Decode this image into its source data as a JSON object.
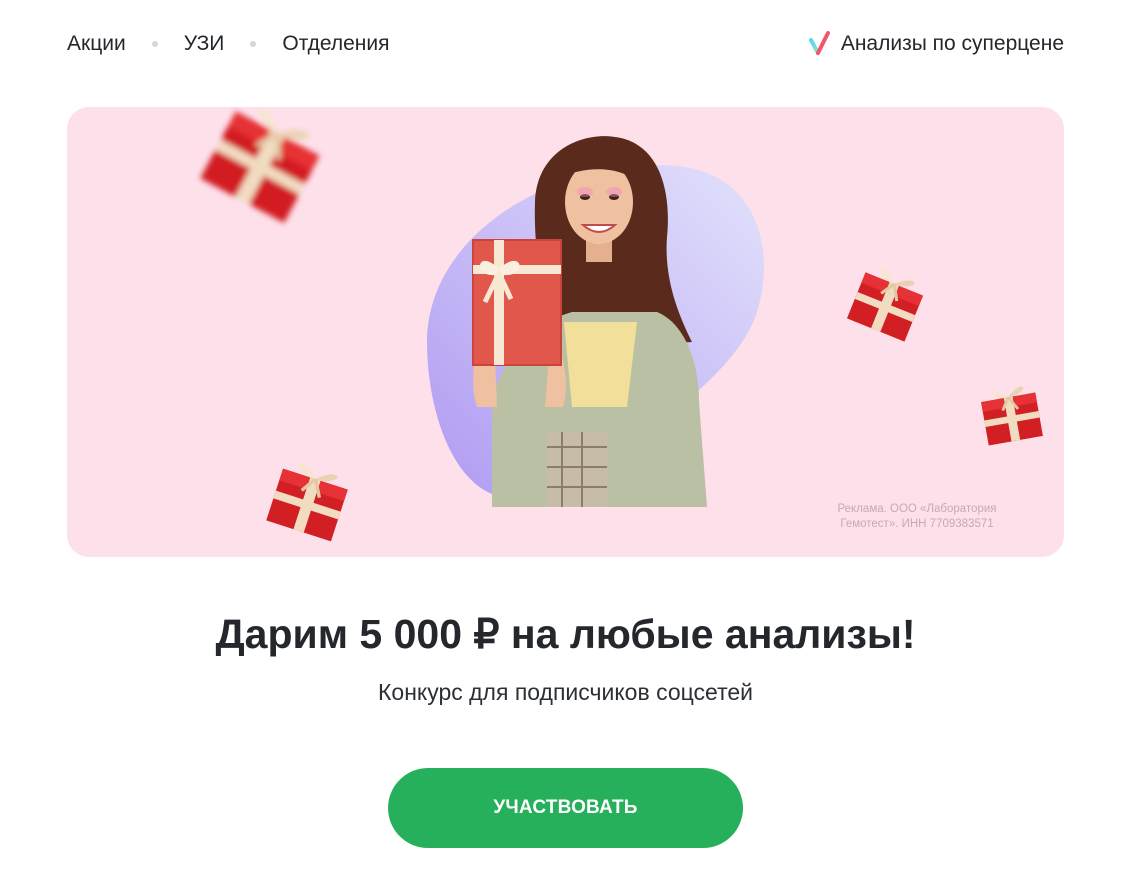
{
  "nav": {
    "items": [
      {
        "label": "Акции"
      },
      {
        "label": "УЗИ"
      },
      {
        "label": "Отделения"
      }
    ],
    "promo": {
      "label": "Анализы по суперцене",
      "icon": "check-mark-logo-icon"
    }
  },
  "banner": {
    "disclaimer_line1": "Реклама. ООО «Лаборатория",
    "disclaimer_line2": "Гемотест». ИНН 7709383571",
    "background_color": "#fde0ea"
  },
  "headline": "Дарим 5 000 ₽ на любые анализы!",
  "subheadline": "Конкурс для подписчиков соцсетей",
  "cta": {
    "label": "УЧАСТВОВАТЬ",
    "color": "#27b05c"
  }
}
